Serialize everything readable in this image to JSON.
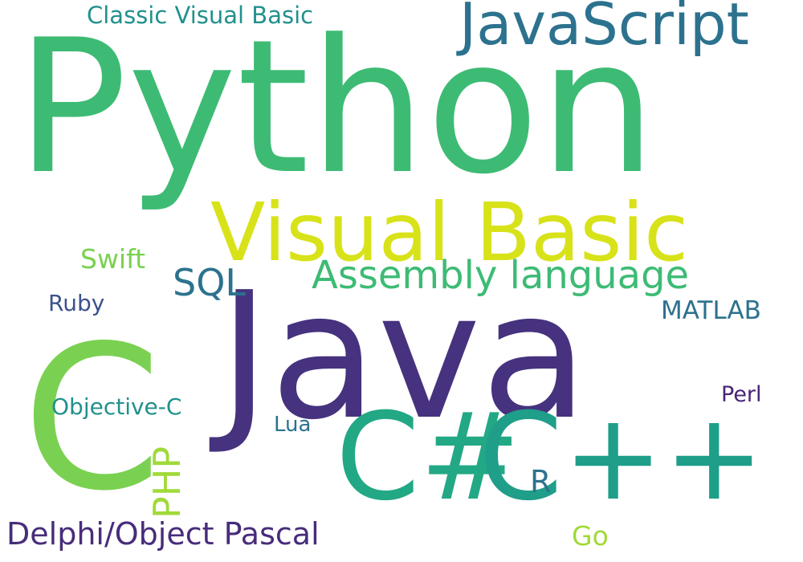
{
  "words": {
    "python": {
      "text": "Python",
      "color": "#3dbb74"
    },
    "java": {
      "text": "Java",
      "color": "#46327e"
    },
    "visual_basic": {
      "text": "Visual Basic",
      "color": "#d8e219"
    },
    "javascript": {
      "text": "JavaScript",
      "color": "#2c728e"
    },
    "c": {
      "text": "C",
      "color": "#7ad151"
    },
    "csharp": {
      "text": "C#",
      "color": "#22a884"
    },
    "cpp": {
      "text": "C++",
      "color": "#1f9e89"
    },
    "assembly": {
      "text": "Assembly language",
      "color": "#3dbb74"
    },
    "sql": {
      "text": "SQL",
      "color": "#2c728e"
    },
    "swift": {
      "text": "Swift",
      "color": "#7ad151"
    },
    "classic_vb": {
      "text": "Classic Visual Basic",
      "color": "#21918c"
    },
    "ruby": {
      "text": "Ruby",
      "color": "#3b528b"
    },
    "matlab": {
      "text": "MATLAB",
      "color": "#2c728e"
    },
    "objective_c": {
      "text": "Objective-C",
      "color": "#21918c"
    },
    "php": {
      "text": "PHP",
      "color": "#a0da39"
    },
    "lua": {
      "text": "Lua",
      "color": "#2c728e"
    },
    "perl": {
      "text": "Perl",
      "color": "#482475"
    },
    "r": {
      "text": "R",
      "color": "#2c728e"
    },
    "delphi": {
      "text": "Delphi/Object Pascal",
      "color": "#472d7b"
    },
    "go": {
      "text": "Go",
      "color": "#a0da39"
    }
  }
}
